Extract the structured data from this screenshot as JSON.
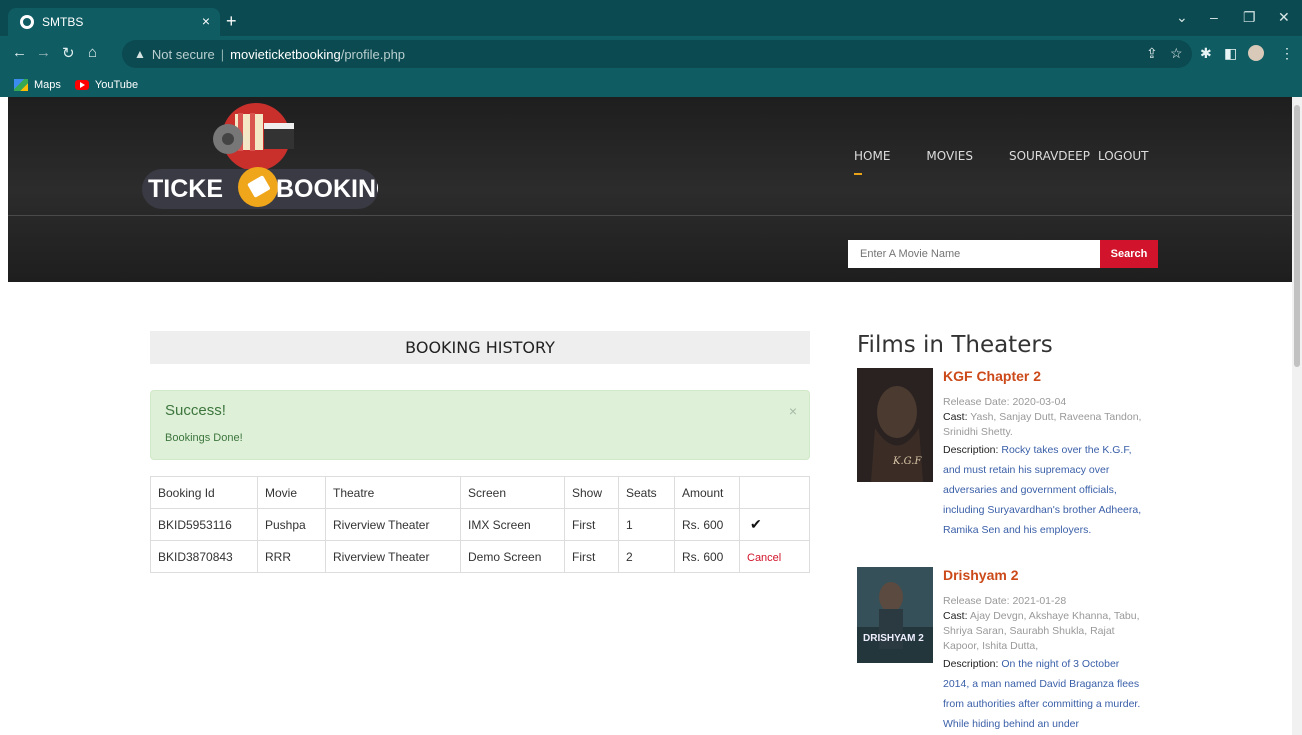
{
  "browser": {
    "tab_title": "SMTBS",
    "address": {
      "warning": "Not secure",
      "host": "movieticketbooking",
      "path": "/profile.php"
    },
    "bookmarks": [
      "Maps",
      "YouTube"
    ]
  },
  "site": {
    "logo_text_left": "TICKE",
    "logo_text_right": "BOOKING",
    "menu": [
      "HOME",
      "MOVIES",
      "SOURAVDEEP",
      "LOGOUT"
    ],
    "search_placeholder": "Enter A Movie Name",
    "search_button": "Search"
  },
  "booking": {
    "heading": "BOOKING HISTORY",
    "alert_title": "Success!",
    "alert_text": "Bookings Done!",
    "alert_close": "×",
    "columns": [
      "Booking Id",
      "Movie",
      "Theatre",
      "Screen",
      "Show",
      "Seats",
      "Amount",
      ""
    ],
    "rows": [
      {
        "id": "BKID5953116",
        "movie": "Pushpa",
        "theatre": "Riverview Theater",
        "screen": "IMX Screen",
        "show": "First",
        "seats": "1",
        "amount": "Rs. 600",
        "action": "✔"
      },
      {
        "id": "BKID3870843",
        "movie": "RRR",
        "theatre": "Riverview Theater",
        "screen": "Demo Screen",
        "show": "First",
        "seats": "2",
        "amount": "Rs. 600",
        "action": "Cancel"
      }
    ]
  },
  "sidebar": {
    "title": "Films in Theaters",
    "films": [
      {
        "title": "KGF Chapter 2",
        "release_label": "Release Date:",
        "release": "2020-03-04",
        "cast_label": "Cast:",
        "cast": "Yash, Sanjay Dutt, Raveena Tandon, Srinidhi Shetty.",
        "desc_label": "Description:",
        "desc": "Rocky takes over the K.G.F, and must retain his supremacy over adversaries and government officials, including Suryavardhan's brother Adheera, Ramika Sen and his employers.",
        "poster_text": "K.G.F"
      },
      {
        "title": "Drishyam 2",
        "release_label": "Release Date:",
        "release": "2021-01-28",
        "cast_label": "Cast:",
        "cast": "Ajay Devgn, Akshaye Khanna, Tabu, Shriya Saran, Saurabh Shukla, Rajat Kapoor, Ishita Dutta,",
        "desc_label": "Description:",
        "desc": "On the night of 3 October 2014, a man named David Braganza flees from authorities after committing a murder. While hiding behind an under",
        "poster_text": "DRISHYAM 2"
      }
    ]
  }
}
